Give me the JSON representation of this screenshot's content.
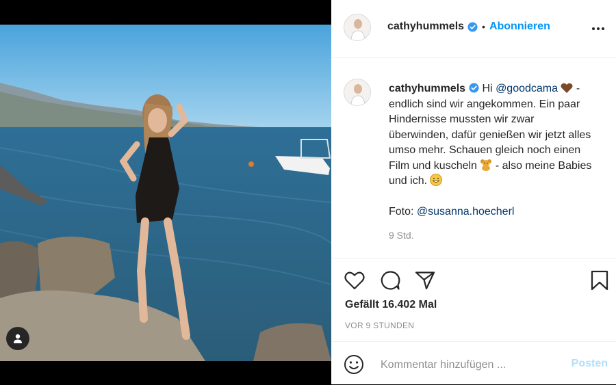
{
  "post": {
    "username": "cathyhummels",
    "follow_label": "Abonnieren",
    "caption": {
      "intro": "Hi ",
      "mention1": "@goodcama",
      "body": " - endlich sind wir angekommen. Ein paar Hindernisse mussten wir zwar überwinden, dafür genießen wir jetzt alles umso mehr. Schauen gleich noch einen Film und kuscheln ",
      "body2": " - also meine Babies und ich. ",
      "photo_credit_label": "Foto: ",
      "mention2": "@susanna.hoecherl"
    },
    "caption_time": "9 Std.",
    "likes": "Gefällt 16.402 Mal",
    "posted_ago": "VOR 9 STUNDEN",
    "comment_placeholder": "Kommentar hinzufügen ...",
    "post_label": "Posten"
  },
  "colors": {
    "accent": "#0095f6",
    "mention": "#00376b",
    "muted": "#8e8e8e",
    "post_disabled": "#b2dffc",
    "text": "#262626"
  },
  "icons": {
    "header_more": "more-dots-icon",
    "verified": "verified-badge-icon",
    "like": "heart-icon",
    "comment": "comment-bubble-icon",
    "share": "paper-plane-icon",
    "save": "bookmark-icon",
    "emoji": "smiley-icon",
    "tag": "user-tag-icon",
    "heart_emoji": "brown-heart-emoji",
    "bear_emoji": "teddy-bear-emoji",
    "grin_emoji": "grinning-face-emoji"
  }
}
